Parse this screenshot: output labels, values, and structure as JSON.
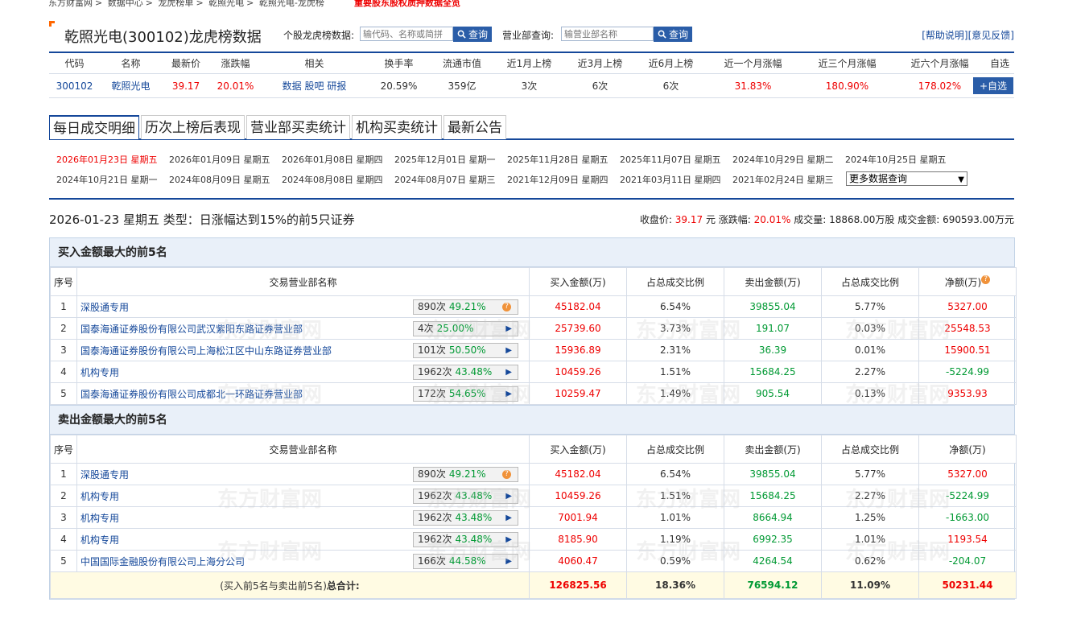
{
  "breadcrumb": [
    "东方财富网",
    "数据中心",
    "龙虎榜单",
    "乾照光电",
    "乾照光电-龙虎榜"
  ],
  "breadcrumb_hot": "重要股东股权质押数据全览",
  "stock_title": "乾照光电(300102)龙虎榜数据",
  "stock_search": {
    "label": "个股龙虎榜数据:",
    "placeholder": "输代码、名称或简拼",
    "button": "查询"
  },
  "dept_search": {
    "label": "营业部查询:",
    "placeholder": "输营业部名称",
    "button": "查询"
  },
  "top_links": {
    "help": "[帮助说明]",
    "feedback": "[意见反馈]"
  },
  "summary": {
    "headers": [
      "代码",
      "名称",
      "最新价",
      "涨跌幅",
      "相关",
      "换手率",
      "流通市值",
      "近1月上榜",
      "近3月上榜",
      "近6月上榜",
      "近一个月涨幅",
      "近三个月涨幅",
      "近六个月涨幅",
      "自选"
    ],
    "row": {
      "code": "300102",
      "name": "乾照光电",
      "price": "39.17",
      "change": "20.01%",
      "related": [
        "数据",
        "股吧",
        "研报"
      ],
      "turnover": "20.59%",
      "float_cap": "359亿",
      "m1": "3次",
      "m3": "6次",
      "m6": "6次",
      "r1": "31.83%",
      "r3": "180.90%",
      "r6": "178.02%",
      "add": "+自选"
    }
  },
  "tabs": [
    "每日成交明细",
    "历次上榜后表现",
    "营业部买卖统计",
    "机构买卖统计",
    "最新公告"
  ],
  "dates_row1": [
    "2026年01月23日 星期五",
    "2026年01月09日 星期五",
    "2026年01月08日 星期四",
    "2025年12月01日 星期一",
    "2025年11月28日 星期五",
    "2025年11月07日 星期五",
    "2024年10月29日 星期二",
    "2024年10月25日 星期五"
  ],
  "dates_row2": [
    "2024年10月21日 星期一",
    "2024年08月09日 星期五",
    "2024年08月08日 星期四",
    "2024年08月07日 星期三",
    "2021年12月09日 星期四",
    "2021年03月11日 星期四",
    "2021年02月24日 星期三"
  ],
  "more_select": "更多数据查询",
  "day_line": "2026-01-23 星期五 类型：日涨幅达到15%的前5只证券",
  "day_info": {
    "close_label": "收盘价:",
    "close": "39.17",
    "close_unit": "元",
    "chg_label": "涨跌幅:",
    "chg": "20.01%",
    "vol_label": "成交量:",
    "vol": "18868.00万股",
    "amt_label": "成交金额:",
    "amt": "690593.00万元"
  },
  "col_headers": [
    "序号",
    "交易营业部名称",
    "买入金额(万)",
    "占总成交比例",
    "卖出金额(万)",
    "占总成交比例",
    "净额(万)"
  ],
  "buy": {
    "title": "买入金额最大的前5名",
    "rows": [
      {
        "no": "1",
        "name": "深股通专用",
        "times": "890次",
        "rate": "49.21%",
        "q": true,
        "buy": "45182.04",
        "bp": "6.54%",
        "sell": "39855.04",
        "sp": "5.77%",
        "net": "5327.00",
        "neg": false
      },
      {
        "no": "2",
        "name": "国泰海通证券股份有限公司武汉紫阳东路证券营业部",
        "times": "4次",
        "rate": "25.00%",
        "q": false,
        "buy": "25739.60",
        "bp": "3.73%",
        "sell": "191.07",
        "sp": "0.03%",
        "net": "25548.53",
        "neg": false
      },
      {
        "no": "3",
        "name": "国泰海通证券股份有限公司上海松江区中山东路证券营业部",
        "times": "101次",
        "rate": "50.50%",
        "q": false,
        "buy": "15936.89",
        "bp": "2.31%",
        "sell": "36.39",
        "sp": "0.01%",
        "net": "15900.51",
        "neg": false
      },
      {
        "no": "4",
        "name": "机构专用",
        "times": "1962次",
        "rate": "43.48%",
        "q": false,
        "buy": "10459.26",
        "bp": "1.51%",
        "sell": "15684.25",
        "sp": "2.27%",
        "net": "-5224.99",
        "neg": true
      },
      {
        "no": "5",
        "name": "国泰海通证券股份有限公司成都北一环路证券营业部",
        "times": "172次",
        "rate": "54.65%",
        "q": false,
        "buy": "10259.47",
        "bp": "1.49%",
        "sell": "905.54",
        "sp": "0.13%",
        "net": "9353.93",
        "neg": false
      }
    ]
  },
  "sell": {
    "title": "卖出金额最大的前5名",
    "rows": [
      {
        "no": "1",
        "name": "深股通专用",
        "times": "890次",
        "rate": "49.21%",
        "q": true,
        "buy": "45182.04",
        "bp": "6.54%",
        "sell": "39855.04",
        "sp": "5.77%",
        "net": "5327.00",
        "neg": false
      },
      {
        "no": "2",
        "name": "机构专用",
        "times": "1962次",
        "rate": "43.48%",
        "q": false,
        "buy": "10459.26",
        "bp": "1.51%",
        "sell": "15684.25",
        "sp": "2.27%",
        "net": "-5224.99",
        "neg": true
      },
      {
        "no": "3",
        "name": "机构专用",
        "times": "1962次",
        "rate": "43.48%",
        "q": false,
        "buy": "7001.94",
        "bp": "1.01%",
        "sell": "8664.94",
        "sp": "1.25%",
        "net": "-1663.00",
        "neg": true
      },
      {
        "no": "4",
        "name": "机构专用",
        "times": "1962次",
        "rate": "43.48%",
        "q": false,
        "buy": "8185.90",
        "bp": "1.19%",
        "sell": "6992.35",
        "sp": "1.01%",
        "net": "1193.54",
        "neg": false
      },
      {
        "no": "5",
        "name": "中国国际金融股份有限公司上海分公司",
        "times": "166次",
        "rate": "44.58%",
        "q": false,
        "buy": "4060.47",
        "bp": "0.59%",
        "sell": "4264.54",
        "sp": "0.62%",
        "net": "-204.07",
        "neg": true
      }
    ]
  },
  "total": {
    "label_a": "(买入前5名与卖出前5名)",
    "label_b": "总合计:",
    "buy": "126825.56",
    "bp": "18.36%",
    "sell": "76594.12",
    "sp": "11.09%",
    "net": "50231.44"
  },
  "watermark": "东方财富网",
  "colors": {
    "brand_blue": "#15489a",
    "up_red": "#e00",
    "down_green": "#093",
    "accent_orange": "#f60"
  }
}
